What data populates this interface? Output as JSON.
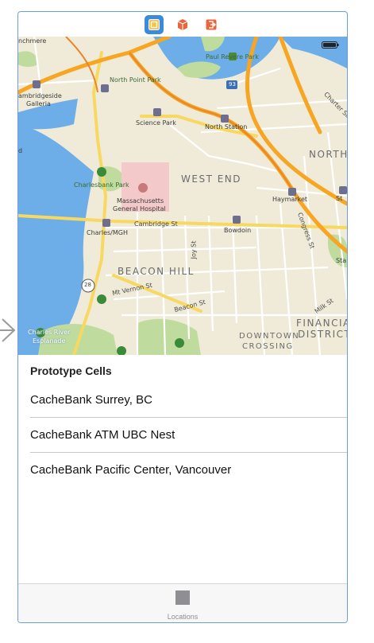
{
  "scene": {
    "dock_icons": [
      "view-controller-icon",
      "first-responder-icon",
      "exit-icon"
    ]
  },
  "map": {
    "labels": {
      "nchmere": "nchmere",
      "paul_revere_park": "Paul Revere Park",
      "north_point_park": "North Point Park",
      "cambridgeside_1": "ambridgeside",
      "cambridgeside_2": "Galleria",
      "science_park": "Science Park",
      "north_station": "North Station",
      "charter_st": "Charter St",
      "north": "NORTH",
      "west_end": "WEST END",
      "charlesbank_park": "Charlesbank Park",
      "mgh_1": "Massachusetts",
      "mgh_2": "General Hospital",
      "haymarket": "Haymarket",
      "charles_mgh": "Charles/MGH",
      "cambridge_st": "Cambridge St",
      "bowdoin": "Bowdoin",
      "congress_st": "Congress St",
      "joy_st": "Joy St",
      "beacon_hill": "BEACON HILL",
      "mt_vernon_st": "Mt Vernon St",
      "beacon_st": "Beacon St",
      "milk_st": "Milk St",
      "financial_1": "FINANCIA",
      "financial_2": "DISTRICT",
      "charles_river_1": "Charles River",
      "charles_river_2": "Esplanade",
      "downtown_1": "DOWNTOWN",
      "downtown_2": "CROSSING",
      "sta": "Sta",
      "shield_93": "93",
      "shield_28": "28",
      "d": "d",
      "st_cut": "St"
    }
  },
  "table": {
    "section_header": "Prototype Cells",
    "cells": [
      {
        "label": "CacheBank Surrey, BC"
      },
      {
        "label": "CacheBank ATM UBC Nest"
      },
      {
        "label": "CacheBank Pacific Center, Vancouver"
      }
    ]
  },
  "tabbar": {
    "items": [
      {
        "label": "Locations",
        "icon": "square-tab-icon"
      }
    ]
  },
  "colors": {
    "accent": "#3a8bdc",
    "scene_border": "#6f9fd8",
    "water": "#6eaee8",
    "land": "#f0ebd8",
    "park": "#bfdc9e",
    "highway": "#f6a623",
    "major_road": "#f7d860"
  }
}
